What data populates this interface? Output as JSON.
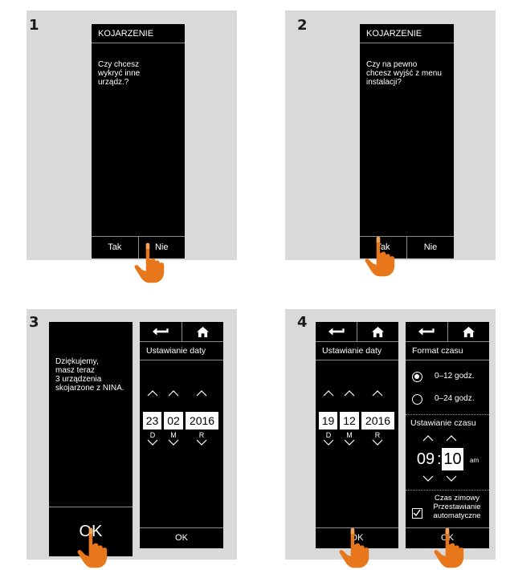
{
  "colors": {
    "panel": "#d9d9d9",
    "screen": "#000000",
    "hand": "#e8761a",
    "divider": "#8a8a8a"
  },
  "step1": {
    "number": "1",
    "title": "KOJARZENIE",
    "message": "Czy chcesz\nwykryć inne\nurządz.?",
    "btn_yes": "Tak",
    "btn_no": "Nie"
  },
  "step2": {
    "number": "2",
    "title": "KOJARZENIE",
    "message": "Czy na pewno\nchcesz wyjść z menu\ninstalacji?",
    "btn_yes": "Tak",
    "btn_no": "Nie"
  },
  "step3": {
    "number": "3",
    "message": "Dziękujemy,\nmasz teraz\n3 urządzenia\nskojarzone z NINA.",
    "ok_big": "OK",
    "date_title": "Ustawianie daty",
    "day": "23",
    "month": "02",
    "year": "2016",
    "day_label": "D",
    "month_label": "M",
    "year_label": "R",
    "ok": "OK"
  },
  "step4": {
    "number": "4",
    "date_title": "Ustawianie daty",
    "day": "19",
    "month": "12",
    "year": "2016",
    "day_label": "D",
    "month_label": "M",
    "year_label": "R",
    "ok_left": "OK",
    "format_title": "Format czasu",
    "opt_12": "0–12 godz.",
    "opt_24": "0–24 godz.",
    "time_title": "Ustawianie czasu",
    "hour": "09",
    "minute": "10",
    "ampm": "am",
    "dst_line1": "Czas zimowy",
    "dst_line2": "Przestawianie",
    "dst_line3": "automatyczne",
    "ok_right": "OK"
  },
  "icons": {
    "back": "back-arrow-icon",
    "home": "home-icon",
    "hand": "pointing-hand-icon",
    "chevron_up": "chevron-up-icon",
    "chevron_down": "chevron-down-icon",
    "checkbox": "checkbox-checked-icon",
    "radio": "radio-button"
  }
}
